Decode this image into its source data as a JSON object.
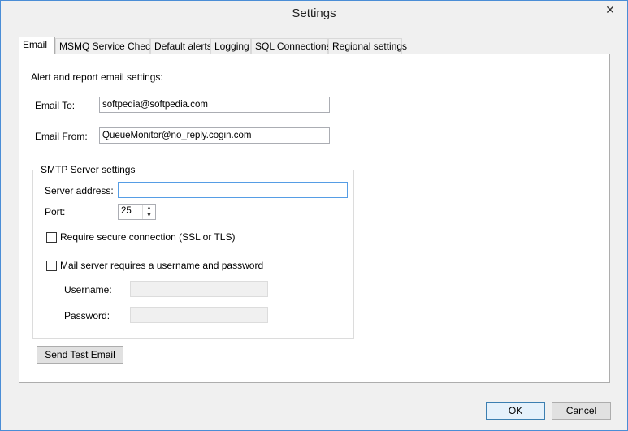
{
  "window": {
    "title": "Settings",
    "close_glyph": "✕"
  },
  "tabs": [
    {
      "label": "Email"
    },
    {
      "label": "MSMQ Service Check"
    },
    {
      "label": "Default alerts"
    },
    {
      "label": "Logging"
    },
    {
      "label": "SQL Connections"
    },
    {
      "label": "Regional settings"
    }
  ],
  "email": {
    "heading": "Alert and report email settings:",
    "to_label": "Email To:",
    "to_value": "softpedia@softpedia.com",
    "from_label": "Email From:",
    "from_value": "QueueMonitor@no_reply.cogin.com"
  },
  "smtp": {
    "group_title": "SMTP Server settings",
    "server_label": "Server address:",
    "server_value": "",
    "port_label": "Port:",
    "port_value": "25",
    "secure_label": "Require secure connection (SSL or TLS)",
    "secure_checked": false,
    "auth_label": "Mail server requires a username and password",
    "auth_checked": false,
    "username_label": "Username:",
    "username_value": "",
    "password_label": "Password:",
    "password_value": ""
  },
  "actions": {
    "test_label": "Send Test Email",
    "ok_label": "OK",
    "cancel_label": "Cancel"
  }
}
